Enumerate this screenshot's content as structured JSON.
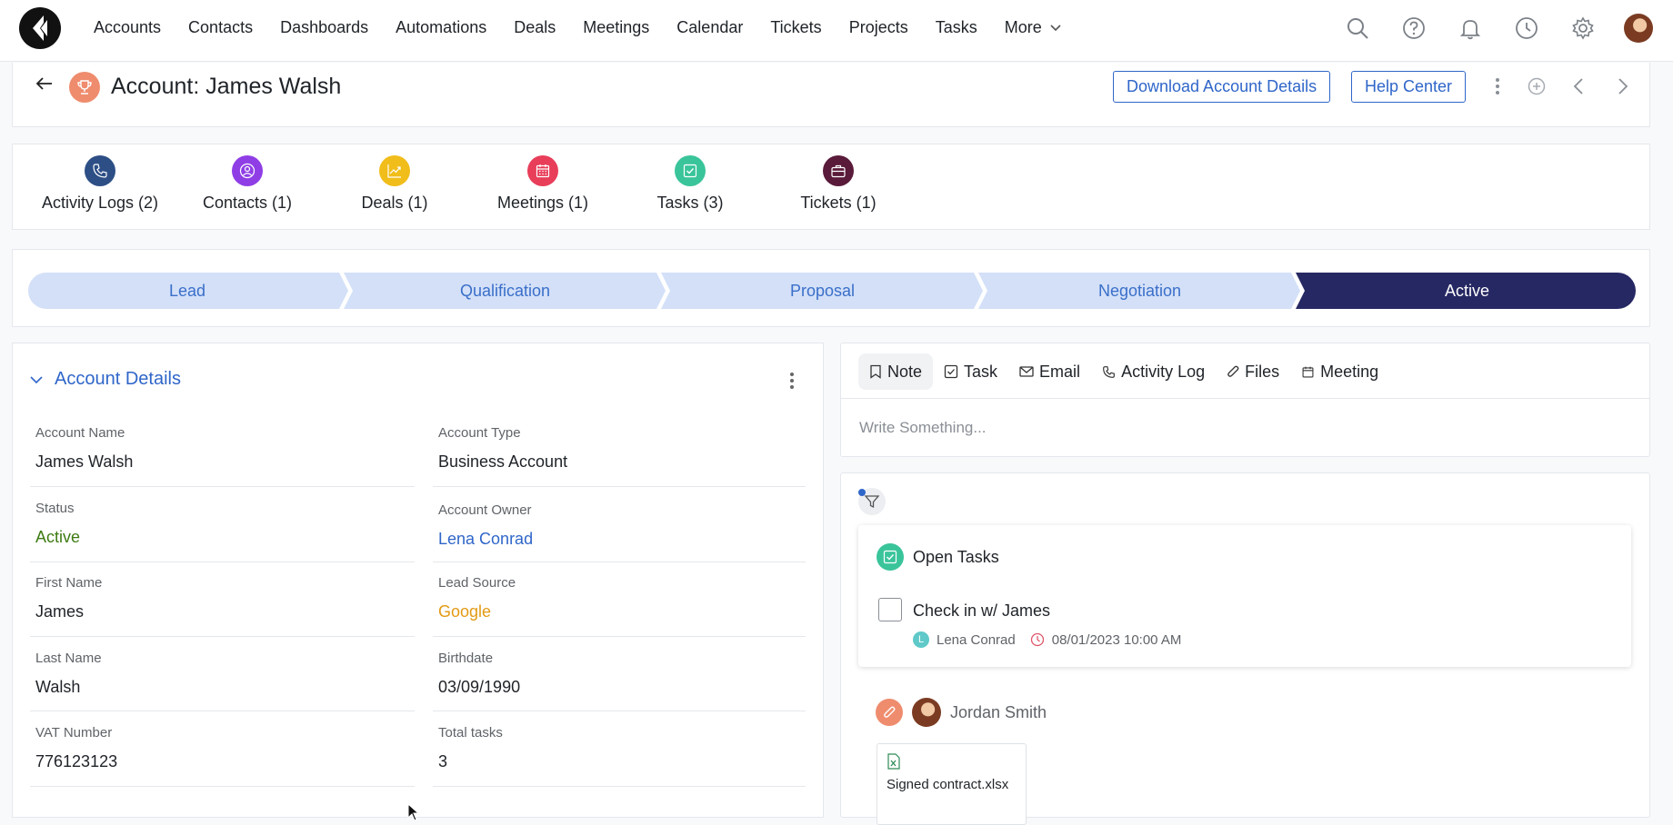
{
  "nav": {
    "items": [
      "Accounts",
      "Contacts",
      "Dashboards",
      "Automations",
      "Deals",
      "Meetings",
      "Calendar",
      "Tickets",
      "Projects",
      "Tasks"
    ],
    "more_label": "More"
  },
  "header": {
    "title": "Account: James Walsh",
    "download_label": "Download Account Details",
    "help_label": "Help Center"
  },
  "related": [
    {
      "label": "Activity Logs (2)",
      "color": "#2d4f86",
      "icon": "phone-icon"
    },
    {
      "label": "Contacts (1)",
      "color": "#8f3ee6",
      "icon": "contact-icon"
    },
    {
      "label": "Deals (1)",
      "color": "#f1bd1a",
      "icon": "chart-up-icon"
    },
    {
      "label": "Meetings (1)",
      "color": "#e83e5a",
      "icon": "calendar-icon"
    },
    {
      "label": "Tasks (3)",
      "color": "#3ac49a",
      "icon": "checkbox-icon"
    },
    {
      "label": "Tickets (1)",
      "color": "#5a1a3a",
      "icon": "briefcase-icon"
    }
  ],
  "pipeline": {
    "stages": [
      "Lead",
      "Qualification",
      "Proposal",
      "Negotiation",
      "Active"
    ],
    "active_stage": "Active",
    "inactive_color": "#d3e0f8",
    "active_color": "#262863"
  },
  "details": {
    "title": "Account Details",
    "left": [
      {
        "label": "Account Name",
        "value": "James Walsh"
      },
      {
        "label": "Status",
        "value": "Active"
      },
      {
        "label": "First Name",
        "value": "James"
      },
      {
        "label": "Last Name",
        "value": "Walsh"
      },
      {
        "label": "VAT Number",
        "value": "776123123"
      }
    ],
    "right": [
      {
        "label": "Account Type",
        "value": "Business Account"
      },
      {
        "label": "Account Owner",
        "value": "Lena Conrad"
      },
      {
        "label": "Lead Source",
        "value": "Google"
      },
      {
        "label": "Birthdate",
        "value": "03/09/1990"
      },
      {
        "label": "Total tasks",
        "value": "3"
      }
    ],
    "colors": {
      "status": "#3e7b12",
      "owner": "#2f66c9",
      "lead_source": "#e39a14"
    }
  },
  "composer": {
    "tabs": [
      "Note",
      "Task",
      "Email",
      "Activity Log",
      "Files",
      "Meeting"
    ],
    "placeholder": "Write Something..."
  },
  "feed": {
    "open_tasks_title": "Open Tasks",
    "task": {
      "title": "Check in w/ James",
      "owner_initial": "L",
      "owner": "Lena Conrad",
      "due": "08/01/2023 10:00 AM"
    },
    "post_author": "Jordan Smith",
    "file_name": "Signed contract.xlsx"
  }
}
